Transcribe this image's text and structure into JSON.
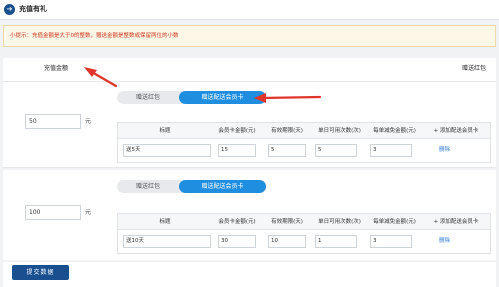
{
  "header": {
    "icon": "arrow-right-icon",
    "icon_glyph": "➔",
    "title": "充值有礼"
  },
  "tip": "小提示：充值金额是大于0的整数，赠送金额是整数或保留两位的小数",
  "columns": {
    "recharge_amount": "充值金额",
    "gift_red_packet": "赠送红包"
  },
  "tiers": [
    {
      "toggle": {
        "gift_red": "赠送红包",
        "gift_card": "赠送配送会员卡",
        "active": "gift_card"
      },
      "amount": "50",
      "unit": "元",
      "table_headers": [
        "标题",
        "会员卡金额(元)",
        "有效期限(天)",
        "单日可用次数(次)",
        "每单减免金额(元)",
        "+ 添加配送会员卡"
      ],
      "row": {
        "title": "送5天",
        "card_amount": "15",
        "valid_days": "5",
        "daily_uses": "5",
        "discount": "3",
        "delete": "删除"
      }
    },
    {
      "toggle": {
        "gift_red": "赠送红包",
        "gift_card": "赠送配送会员卡",
        "active": "gift_card"
      },
      "amount": "100",
      "unit": "元",
      "table_headers": [
        "标题",
        "会员卡金额(元)",
        "有效期限(天)",
        "单日可用次数(次)",
        "每单减免金额(元)",
        "+ 添加配送会员卡"
      ],
      "row": {
        "title": "送10天",
        "card_amount": "30",
        "valid_days": "10",
        "daily_uses": "1",
        "discount": "3",
        "delete": "删除"
      }
    }
  ],
  "submit_label": "提交数据",
  "colors": {
    "primary": "#1a4f8f",
    "toggle_active": "#1f8ee0",
    "tip_text": "#d03a1e",
    "link": "#2a7ad6",
    "annotation": "#e0352b"
  }
}
